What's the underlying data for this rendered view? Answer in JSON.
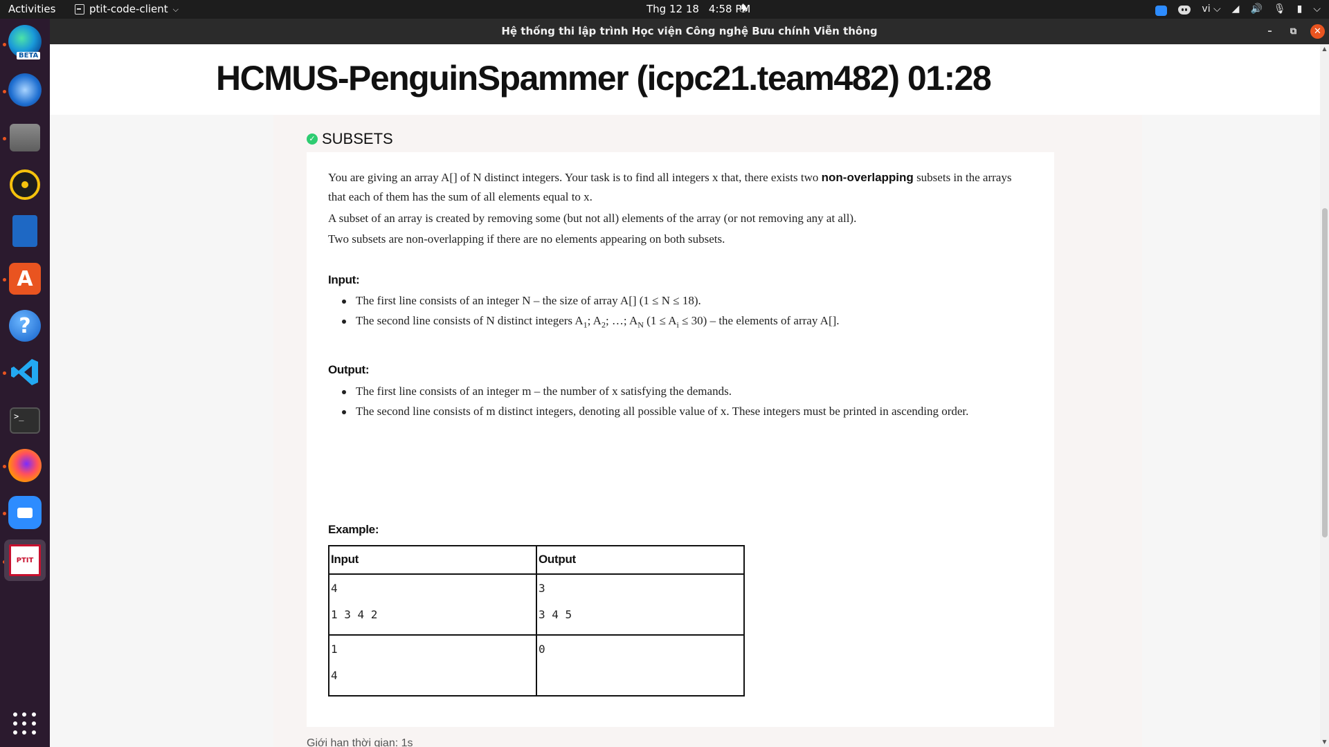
{
  "topbar": {
    "activities": "Activities",
    "app_name": "ptit-code-client",
    "date": "Thg 12 18",
    "time": "4:58 PM",
    "lang": "vi"
  },
  "dock": {
    "edge_badge": "BETA",
    "store_glyph": "A",
    "help_glyph": "?",
    "terminal_glyph": ">_",
    "ptit_label": "PTIT",
    "accent": "#e95420"
  },
  "window": {
    "title": "Hệ thống thi lập trình Học viện Công nghệ Bưu chính Viễn thông"
  },
  "page": {
    "team_header": "HCMUS-PenguinSpammer (icpc21.team482) 01:28",
    "problem_name": "SUBSETS",
    "solved_color": "#2ecc71",
    "statement": {
      "p1_before": "You are giving an array A[] of N distinct integers. Your task is to find all integers x that, there exists two ",
      "p1_bold": "non-overlapping",
      "p1_after": " subsets in the arrays",
      "p1_line2": "that each of them has the sum of all elements equal to x.",
      "p2": "A subset of an array is created by removing some (but not all) elements of the array (or not removing any at all).",
      "p3": "Two subsets are non-overlapping if there are no elements appearing on both subsets."
    },
    "input_heading": "Input:",
    "input_line1": "The first line consists of an integer N – the size of array A[] (1 ≤ N ≤ 18).",
    "input_line2": {
      "t1": "The second line consists of N distinct integers A",
      "s1": "1",
      "t2": "; A",
      "s2": "2",
      "t3": "; …; A",
      "s3": "N",
      "t4": " (1 ≤ A",
      "s4": "i",
      "t5": " ≤ 30) – the elements of array A[]."
    },
    "output_heading": "Output:",
    "output_line1": "The first line consists of an integer m – the number of x satisfying the demands.",
    "output_line2": "The second line consists of m distinct integers, denoting all possible value of x. These integers must be printed in ascending order.",
    "example_heading": "Example:",
    "example_table": {
      "headers": [
        "Input",
        "Output"
      ],
      "rows": [
        {
          "input": [
            "4",
            "1 3 4 2"
          ],
          "output": [
            "3",
            "3 4 5"
          ]
        },
        {
          "input": [
            "1",
            "4"
          ],
          "output": [
            "0"
          ]
        }
      ]
    },
    "time_limit": "Giới hạn thời gian: 1s"
  }
}
